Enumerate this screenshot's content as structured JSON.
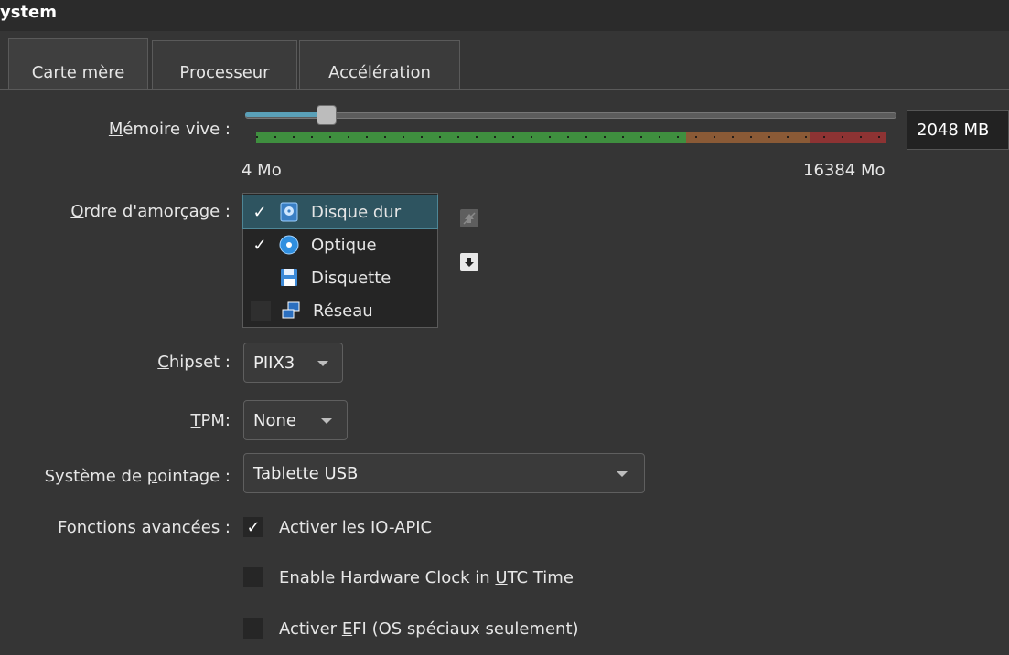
{
  "header": {
    "title": "ystem"
  },
  "tabs": [
    {
      "label_u": "C",
      "label_rest": "arte mère",
      "active": true
    },
    {
      "label_u": "P",
      "label_rest": "rocesseur",
      "active": false
    },
    {
      "label_u": "A",
      "label_rest": "ccélération",
      "active": false
    }
  ],
  "memory": {
    "label_u": "M",
    "label_rest": "émoire vive :",
    "value": "2048 MB",
    "min_label": "4 Mo",
    "max_label": "16384 Mo",
    "fraction": 0.125
  },
  "boot": {
    "label_u": "O",
    "label_rest": "rdre d'amorçage :",
    "items": [
      {
        "label": "Disque dur",
        "checked": true,
        "selected": true,
        "icon": "hard-disk-icon"
      },
      {
        "label": "Optique",
        "checked": true,
        "selected": false,
        "icon": "optical-disc-icon"
      },
      {
        "label": "Disquette",
        "checked": false,
        "selected": false,
        "icon": "floppy-disk-icon"
      },
      {
        "label": "Réseau",
        "checked": false,
        "selected": false,
        "icon": "network-icon"
      }
    ]
  },
  "chipset": {
    "label_u": "C",
    "label_rest": "hipset :",
    "value": "PIIX3"
  },
  "tpm": {
    "label_u": "T",
    "label_rest": "PM:",
    "value": "None"
  },
  "pointing": {
    "label_pre": "Système de ",
    "label_u": "p",
    "label_rest": "ointage :",
    "value": "Tablette USB"
  },
  "advanced": {
    "label": "Fonctions avancées :",
    "options": [
      {
        "pre": "Activer les ",
        "u": "I",
        "post": "O-APIC",
        "checked": true
      },
      {
        "pre": "Enable Hardware Clock in ",
        "u": "U",
        "post": "TC Time",
        "checked": false
      },
      {
        "pre": "Activer ",
        "u": "E",
        "post": "FI (OS spéciaux seulement)",
        "checked": false
      }
    ]
  },
  "colors": {
    "scale_green": "#3f8f3f",
    "scale_orange": "#8a5a36",
    "scale_red": "#8d3333",
    "selection": "#2e5460"
  }
}
